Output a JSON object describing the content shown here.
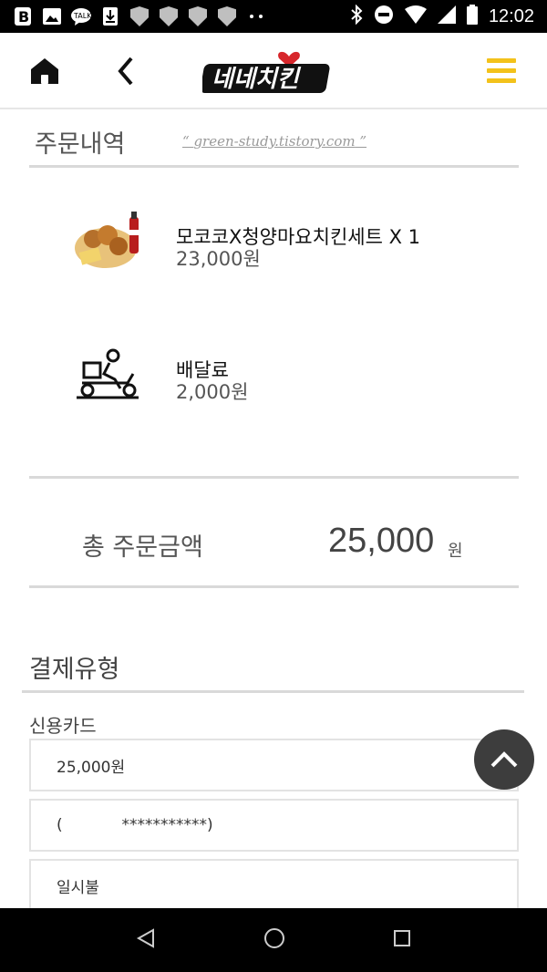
{
  "status_bar": {
    "time": "12:02",
    "left_icons": [
      "blogger-icon",
      "image-icon",
      "message-icon",
      "download-icon",
      "shield-icon",
      "shield-icon",
      "shield-icon",
      "shield-icon",
      "more-icon"
    ],
    "right_icons": [
      "bluetooth-icon",
      "do-not-disturb-icon",
      "wifi-icon",
      "signal-icon",
      "battery-icon"
    ]
  },
  "header": {
    "logo_text": "네네치킨"
  },
  "order": {
    "title": "주문내역",
    "watermark": "green-study.tistory.com",
    "items": [
      {
        "name": "모코코X청양마요치킨세트 X 1",
        "price": "23,000원"
      },
      {
        "name": "배달료",
        "price": "2,000원"
      }
    ]
  },
  "total": {
    "label": "총 주문금액",
    "value": "25,000",
    "unit": "원"
  },
  "payment": {
    "title": "결제유형",
    "method": "신용카드",
    "amount": "25,000원",
    "card": "(            ***********)",
    "installment": "일시불"
  },
  "colors": {
    "accent": "#f3c21b",
    "logo_red": "#d7262b",
    "fab": "#3d3d3d"
  }
}
